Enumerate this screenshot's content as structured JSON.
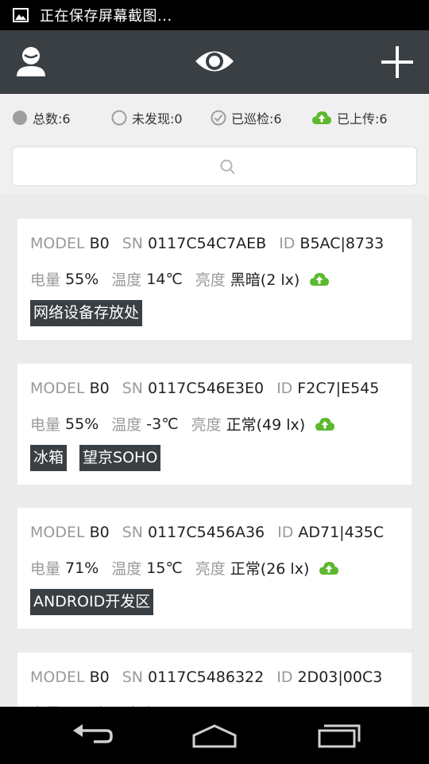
{
  "status_bar": {
    "notification_text": "正在保存屏幕截图..."
  },
  "stats": {
    "total": "总数:6",
    "undiscovered": "未发现:0",
    "inspected": "已巡检:6",
    "uploaded": "已上传:6"
  },
  "search": {
    "placeholder": ""
  },
  "labels": {
    "model": "MODEL",
    "sn": "SN",
    "id": "ID",
    "battery": "电量",
    "temperature": "温度",
    "brightness": "亮度"
  },
  "devices": [
    {
      "model": "B0",
      "sn": "0117C54C7AEB",
      "id": "B5AC|8733",
      "battery": "55%",
      "temperature": "14℃",
      "brightness": "黑暗(2 lx)",
      "tags": [
        "网络设备存放处"
      ]
    },
    {
      "model": "B0",
      "sn": "0117C546E3E0",
      "id": "F2C7|E545",
      "battery": "55%",
      "temperature": "-3℃",
      "brightness": "正常(49 lx)",
      "tags": [
        "冰箱",
        "望京SOHO"
      ]
    },
    {
      "model": "B0",
      "sn": "0117C5456A36",
      "id": "AD71|435C",
      "battery": "71%",
      "temperature": "15℃",
      "brightness": "正常(26 lx)",
      "tags": [
        "ANDROID开发区"
      ]
    },
    {
      "model": "B0",
      "sn": "0117C5486322",
      "id": "2D03|00C3",
      "battery": "",
      "temperature": "",
      "brightness": "",
      "tags": []
    }
  ],
  "colors": {
    "app_bar": "#3a3f44",
    "upload_green": "#5cb82e",
    "tag_bg": "#3a3f44"
  },
  "icons": [
    "image-icon",
    "user-icon",
    "eye-icon",
    "plus-icon",
    "search-icon",
    "cloud-upload-icon",
    "back-icon",
    "home-icon",
    "recent-apps-icon"
  ]
}
